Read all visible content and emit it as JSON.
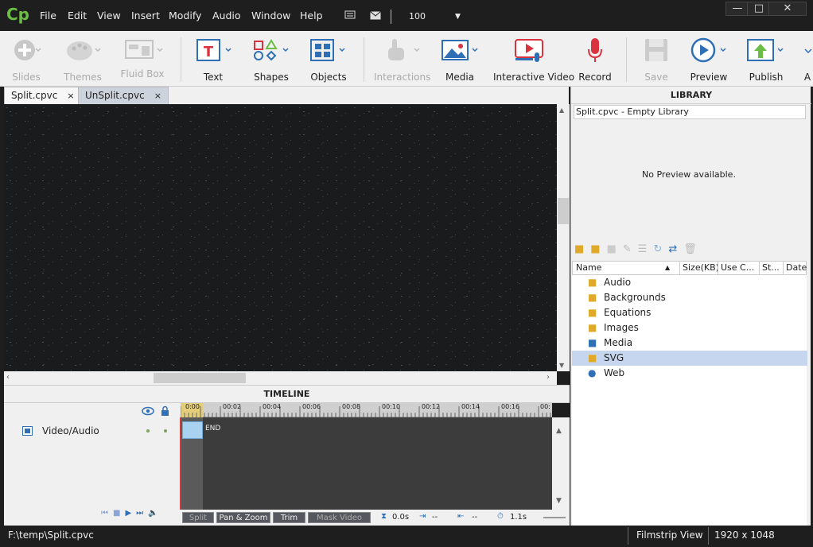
{
  "app": {
    "logo": "Cp"
  },
  "menu": [
    "File",
    "Edit",
    "View",
    "Insert",
    "Modify",
    "Audio",
    "Window",
    "Help"
  ],
  "window_buttons": {
    "minimize": "—",
    "maximize": "□",
    "close": "✕"
  },
  "zoom": "100",
  "toolbar": {
    "slides": "Slides",
    "themes": "Themes",
    "fluid_box": "Fluid Box",
    "text": "Text",
    "shapes": "Shapes",
    "objects": "Objects",
    "interactions": "Interactions",
    "media": "Media",
    "interactive_video": "Interactive Video",
    "record": "Record",
    "save": "Save",
    "preview": "Preview",
    "publish": "Publish",
    "more": "A"
  },
  "tabs": [
    {
      "label": "Split.cpvc",
      "close": "×"
    },
    {
      "label": "UnSplit.cpvc",
      "close": "×"
    }
  ],
  "timeline": {
    "title": "TIMELINE",
    "track_label": "Video/Audio",
    "ticks": [
      "0:00",
      "00:02",
      "00:04",
      "00:06",
      "00:08",
      "00:10",
      "00:12",
      "00:14",
      "00:16",
      "00:"
    ],
    "end_label": "END",
    "buttons": {
      "split": "Split",
      "pan_zoom": "Pan & Zoom",
      "trim": "Trim",
      "mask_video": "Mask Video"
    },
    "time_value": "0.0s",
    "in_value": "--",
    "out_value": "--",
    "duration": "1.1s"
  },
  "library": {
    "title": "LIBRARY",
    "subtitle": "Split.cpvc - Empty Library",
    "no_preview": "No Preview available.",
    "columns": [
      "Name",
      "Size(KB)",
      "Use C...",
      "St...",
      "Date"
    ],
    "folders": [
      "Audio",
      "Backgrounds",
      "Equations",
      "Images",
      "Media",
      "SVG",
      "Web"
    ],
    "selected": "SVG"
  },
  "status": {
    "path": "F:\\temp\\Split.cpvc",
    "view": "Filmstrip View",
    "resolution": "1920 x 1048"
  },
  "colors": {
    "accent": "#6bbd45",
    "brand_blue": "#2f6fb5",
    "record_red": "#d9333f",
    "selection": "#c6d6ee"
  }
}
